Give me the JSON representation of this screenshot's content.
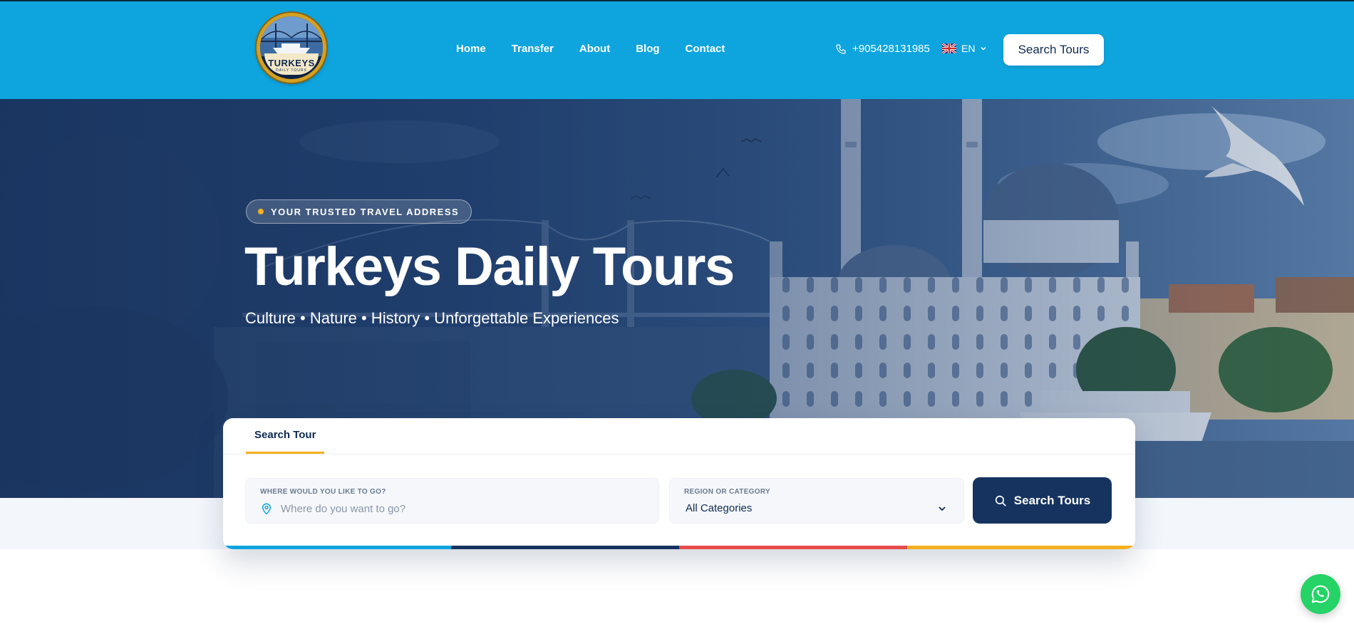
{
  "header": {
    "logo_text": "TURKEYS",
    "logo_subtext": "DAILY TOURS",
    "nav": [
      {
        "label": "Home"
      },
      {
        "label": "Transfer"
      },
      {
        "label": "About"
      },
      {
        "label": "Blog"
      },
      {
        "label": "Contact"
      }
    ],
    "phone": "+905428131985",
    "language": "EN",
    "cta_label": "Search Tours"
  },
  "hero": {
    "badge": "YOUR TRUSTED TRAVEL ADDRESS",
    "title": "Turkeys Daily Tours",
    "subtitle": "Culture • Nature • History • Unforgettable Experiences"
  },
  "search": {
    "tab_label": "Search Tour",
    "destination_label": "WHERE WOULD YOU LIKE TO GO?",
    "destination_placeholder": "Where do you want to go?",
    "category_label": "REGION OR CATEGORY",
    "category_value": "All Categories",
    "button_label": "Search Tours",
    "stripe_colors": [
      "#0ea5df",
      "#16335f",
      "#e84b4b",
      "#f6b01e"
    ]
  },
  "colors": {
    "header_bg": "#0ea5df",
    "navy": "#16335f",
    "accent": "#f6b01e",
    "whatsapp": "#25d366"
  }
}
